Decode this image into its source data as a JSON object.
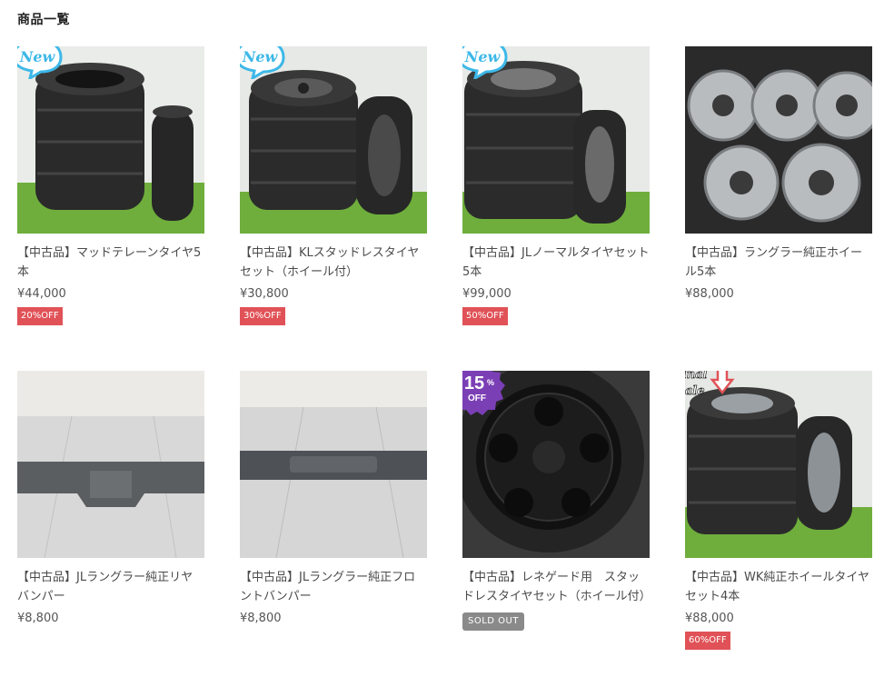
{
  "page": {
    "title": "商品一覧"
  },
  "products": [
    {
      "name": "【中古品】マッドテレーンタイヤ5本",
      "price": "¥44,000",
      "badge": "20%OFF",
      "sticker": "New"
    },
    {
      "name": "【中古品】KLスタッドレスタイヤセット（ホイール付）",
      "price": "¥30,800",
      "badge": "30%OFF",
      "sticker": "New"
    },
    {
      "name": "【中古品】JLノーマルタイヤセット5本",
      "price": "¥99,000",
      "badge": "50%OFF",
      "sticker": "New"
    },
    {
      "name": "【中古品】ラングラー純正ホイール5本",
      "price": "¥88,000",
      "badge": "",
      "sticker": ""
    },
    {
      "name": "【中古品】JLラングラー純正リヤバンパー",
      "price": "¥8,800",
      "badge": "",
      "sticker": ""
    },
    {
      "name": "【中古品】JLラングラー純正フロントバンパー",
      "price": "¥8,800",
      "badge": "",
      "sticker": ""
    },
    {
      "name": "【中古品】レネゲード用　スタッドレスタイヤセット（ホイール付）",
      "price": "",
      "badge": "SOLD OUT",
      "sticker": "15%OFF"
    },
    {
      "name": "【中古品】WK純正ホイールタイヤセット4本",
      "price": "¥88,000",
      "badge": "60%OFF",
      "sticker": "Final Sale"
    }
  ],
  "sticker_text": {
    "new": "New",
    "pct": "15",
    "pct_sign": "%",
    "off": "OFF",
    "final": "Final",
    "sale": "Sale"
  },
  "colors": {
    "badge": "#e05257",
    "soldout": "#8a8a8a",
    "sticker_new": "#3db8e8",
    "sticker_pct": "#7b3fb5"
  }
}
